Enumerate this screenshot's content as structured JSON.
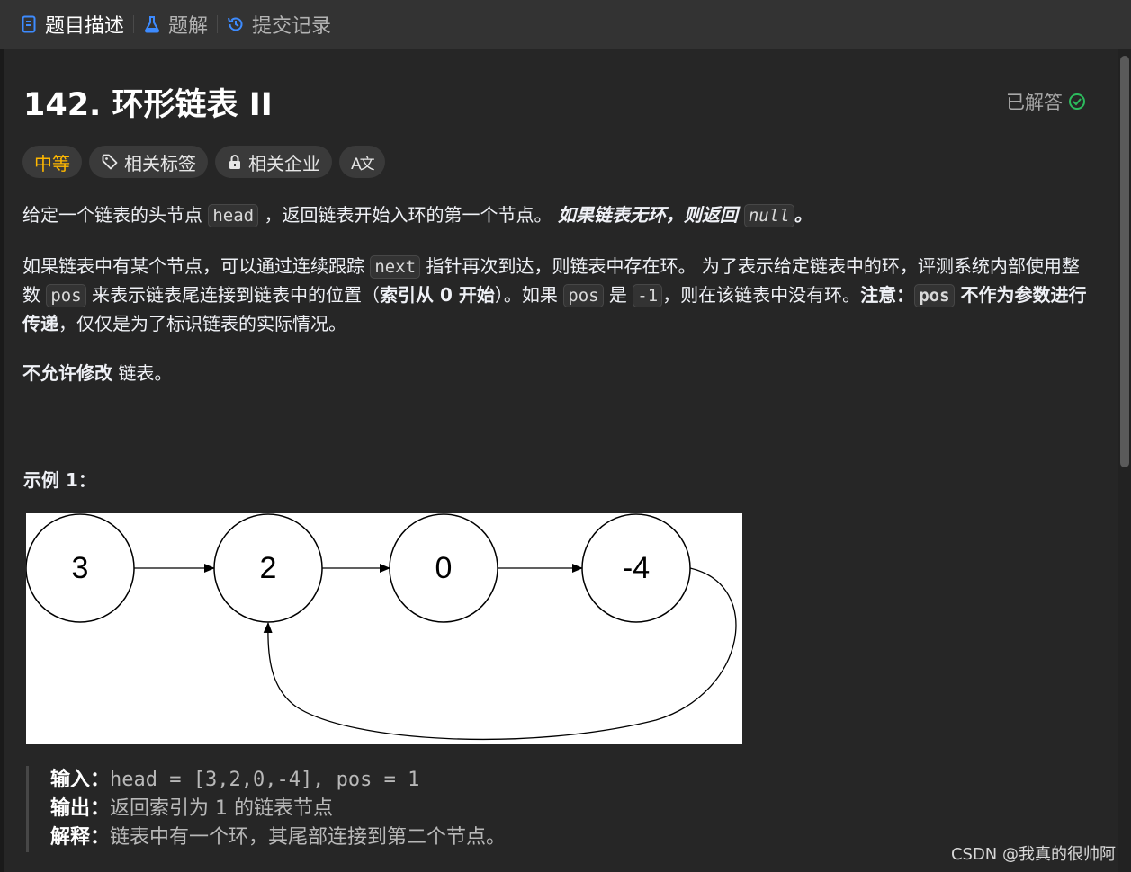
{
  "tabs": [
    {
      "label": "题目描述",
      "icon": "document-icon"
    },
    {
      "label": "题解",
      "icon": "flask-icon"
    },
    {
      "label": "提交记录",
      "icon": "history-icon"
    }
  ],
  "problem": {
    "title": "142. 环形链表 II",
    "status": "已解答",
    "difficulty": "中等",
    "tags": [
      "相关标签",
      "相关企业"
    ],
    "translate_icon_text": "A文"
  },
  "description": {
    "p1": {
      "t1": "给定一个链表的头节点 ",
      "c1": "head",
      "t2": " ，返回链表开始入环的第一个节点。 ",
      "em": "如果链表无环，则返回 ",
      "c2": "null",
      "t3": "。"
    },
    "p2": {
      "t1": "如果链表中有某个节点，可以通过连续跟踪 ",
      "c1": "next",
      "t2": " 指针再次到达，则链表中存在环。 为了表示给定链表中的环，评测系统内部使用整数 ",
      "c2": "pos",
      "t3": " 来表示链表尾连接到链表中的位置（",
      "b1": "索引从 0 开始",
      "t4": "）。如果 ",
      "c3": "pos",
      "t5": " 是 ",
      "c4": "-1",
      "t6": "，则在该链表中没有环。",
      "b2": "注意：",
      "c5": "pos",
      "b3": " 不作为参数进行传递",
      "t7": "，仅仅是为了标识链表的实际情况。"
    },
    "p3": {
      "b1": "不允许修改",
      "t1": " 链表。"
    }
  },
  "example": {
    "title": "示例 1：",
    "diagram_nodes": [
      "3",
      "2",
      "0",
      "-4"
    ],
    "input_label": "输入：",
    "input_value": "head = [3,2,0,-4], pos = 1",
    "output_label": "输出：",
    "output_value": "返回索引为 1 的链表节点",
    "explain_label": "解释：",
    "explain_value": "链表中有一个环，其尾部连接到第二个节点。"
  },
  "watermark": "CSDN @我真的很帅阿",
  "colors": {
    "tab_active_icon": "#3d8bff",
    "difficulty": "#ffb800",
    "solved_check": "#2cbb5d",
    "background": "#262626"
  }
}
